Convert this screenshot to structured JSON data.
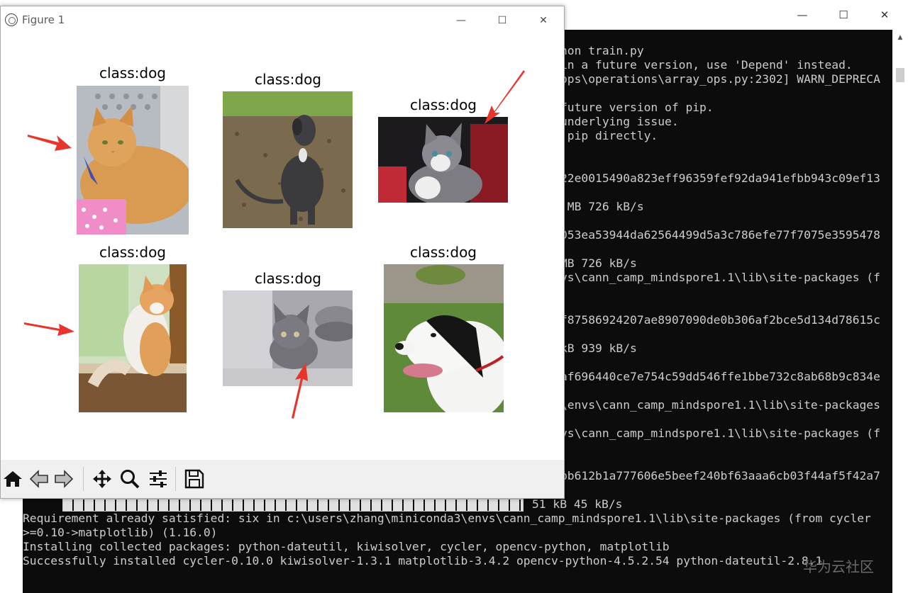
{
  "console": {
    "lines": [
      "hon train.py",
      "in a future version, use 'Depend' instead.",
      "ops\\operations\\array_ops.py:2302] WARN_DEPRECA",
      "",
      "future version of pip.",
      "underlying issue.",
      " pip directly.",
      "",
      "",
      "22e0015490a823eff96359fef92da941efbb943c09ef13",
      "",
      " MB 726 kB/s",
      "",
      "053ea53944da62564499d5a3c786efe77f7075e3595478",
      "",
      "MB 726 kB/s",
      "vs\\cann_camp_mindspore1.1\\lib\\site-packages (f",
      "",
      "f87586924207ae8907090de0b306af2bce5d134d78615c",
      "",
      "kB 939 kB/s",
      "",
      "af696440ce7e754c59dd546ffe1bbe732c8ab68b9c834e",
      "",
      "\\envs\\cann_camp_mindspore1.1\\lib\\site-packages",
      "",
      "vs\\cann_camp_mindspore1.1\\lib\\site-packages (f",
      "",
      "",
      "bb612b1a777606e5beef240bf63aaa6cb03f44af5f42a7"
    ],
    "progress_text": "51 kB 45 kB/s",
    "bottom_lines": [
      "Requirement already satisfied: six in c:\\users\\zhang\\miniconda3\\envs\\cann_camp_mindspore1.1\\lib\\site-packages (from cycler",
      ">=0.10->matplotlib) (1.16.0)",
      "Installing collected packages: python-dateutil, kiwisolver, cycler, opencv-python, matplotlib",
      "Successfully installed cycler-0.10.0 kiwisolver-1.3.1 matplotlib-3.4.2 opencv-python-4.5.2.54 python-dateutil-2.8.1"
    ],
    "watermark": "华为云社区"
  },
  "figure": {
    "title": "Figure 1",
    "subplots": [
      {
        "label": "class:dog",
        "subject": "orange-cat"
      },
      {
        "label": "class:dog",
        "subject": "dark-dog"
      },
      {
        "label": "class:dog",
        "subject": "gray-kitten"
      },
      {
        "label": "class:dog",
        "subject": "white-orange-cat"
      },
      {
        "label": "class:dog",
        "subject": "gray-kitten-2"
      },
      {
        "label": "class:dog",
        "subject": "black-white-dog"
      }
    ]
  },
  "colors": {
    "arrow": "#e8352b",
    "console_bg": "#0c0c0c",
    "console_text": "#cccccc"
  }
}
